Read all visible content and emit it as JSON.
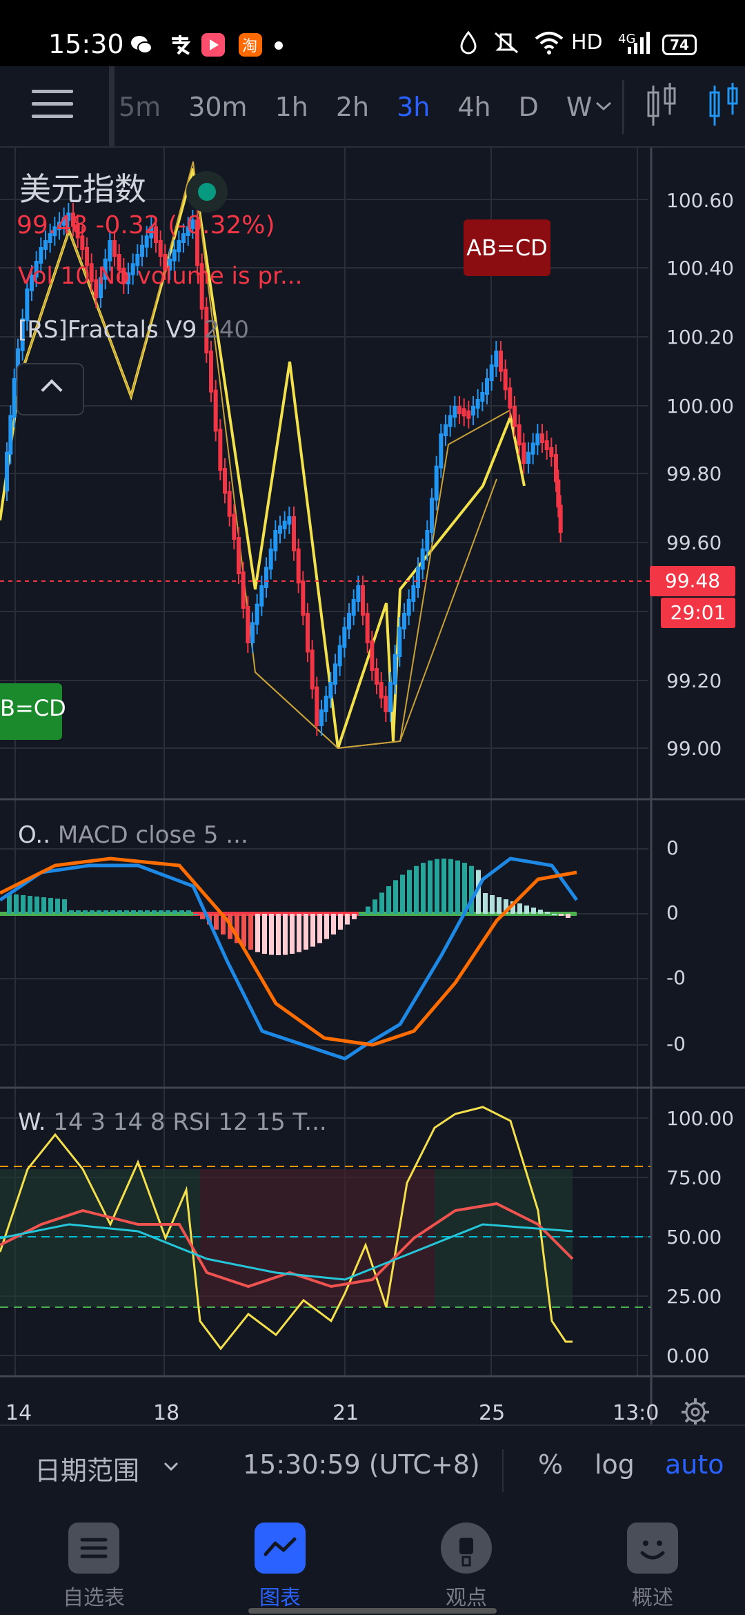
{
  "status_bar": {
    "time": "15:30",
    "apps": [
      "wechat-icon",
      "alipay-icon",
      "video-app-icon",
      "taobao-icon"
    ],
    "network": "HD",
    "signal": "4G",
    "battery": "74"
  },
  "toolbar": {
    "intervals": [
      "5m",
      "30m",
      "1h",
      "2h",
      "3h",
      "4h",
      "D",
      "W"
    ],
    "active_interval": "3h"
  },
  "legend": {
    "symbol": "美元指数",
    "price": "99.48",
    "change": "-0.32 (-0.32%)",
    "volume": "Vol 10  No volume is pr...",
    "indicator_name": "[RS]Fractals V9",
    "indicator_param": "240"
  },
  "annotations": {
    "abcd_top": "AB=CD",
    "abcd_left": "B=CD"
  },
  "price_axis": [
    "100.60",
    "100.40",
    "100.20",
    "100.00",
    "99.80",
    "99.60",
    "99.20",
    "99.00"
  ],
  "last_price": "99.48",
  "countdown": "29:01",
  "macd": {
    "label_short": "O..",
    "label": "MACD close 5 ...",
    "axis": [
      "0",
      "0",
      "-0",
      "-0"
    ]
  },
  "rsi": {
    "label_short": "W.",
    "label": "14 3 14 8 RSI 12 15 T...",
    "axis": [
      "100.00",
      "75.00",
      "50.00",
      "25.00",
      "0.00"
    ]
  },
  "time_axis": [
    "14",
    "18",
    "21",
    "25",
    "13:0"
  ],
  "colors": {
    "bull": "#2196f3",
    "bear": "#f23645",
    "accent": "#2962ff",
    "macd_line": "#1e88e5",
    "signal_line": "#ff6d00",
    "rsi_line": "#f4e04d"
  },
  "range_bar": {
    "date_range": "日期范围",
    "clock": "15:30:59 (UTC+8)",
    "percent": "%",
    "log": "log",
    "auto": "auto"
  },
  "bottom_nav": [
    {
      "label": "自选表",
      "icon": "watchlist-icon"
    },
    {
      "label": "图表",
      "icon": "chart-icon"
    },
    {
      "label": "观点",
      "icon": "ideas-icon"
    },
    {
      "label": "概述",
      "icon": "overview-icon"
    }
  ],
  "active_nav": "图表"
}
